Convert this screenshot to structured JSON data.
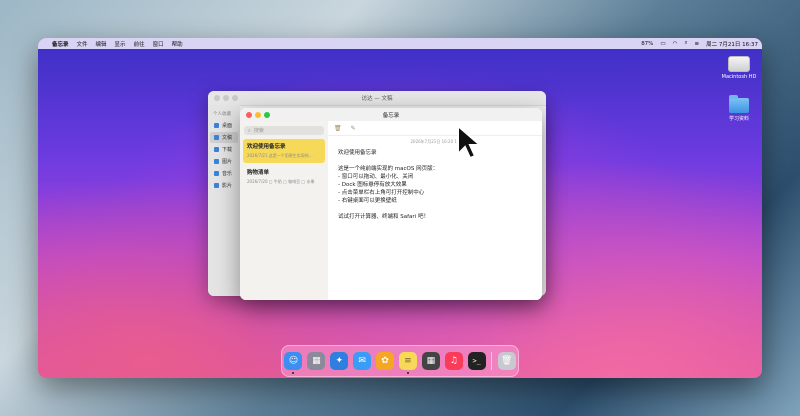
{
  "menubar": {
    "apple": "",
    "app_name": "备忘录",
    "items": [
      "文件",
      "编辑",
      "显示",
      "前往",
      "窗口",
      "帮助"
    ],
    "battery": "87%",
    "datetime": "周二 7月21日 16:37"
  },
  "desktop_icons": [
    {
      "label": "Macintosh HD",
      "icon": "hard-drive-icon"
    },
    {
      "label": "学习资料",
      "icon": "folder-icon"
    }
  ],
  "finder": {
    "title": "访达 — 文稿",
    "section": "个人收藏",
    "items": [
      {
        "label": "桌面",
        "selected": false
      },
      {
        "label": "文稿",
        "selected": true
      },
      {
        "label": "下载",
        "selected": false
      },
      {
        "label": "图片",
        "selected": false
      },
      {
        "label": "音乐",
        "selected": false
      },
      {
        "label": "影片",
        "selected": false
      }
    ]
  },
  "notes": {
    "title": "备忘录",
    "search_placeholder": "搜索",
    "list": [
      {
        "title": "欢迎使用备忘录",
        "meta": "2026/7/21   这是一个用原生实现的…",
        "selected": true
      },
      {
        "title": "购物清单",
        "meta": "2026/7/20   □ 牛奶  □ 咖啡豆  □ 水果",
        "selected": false
      }
    ],
    "toolbar": {
      "delete_icon": "🗑",
      "compose_icon": "✎"
    },
    "date": "2026年7月21日 16:20 16",
    "body_lines": [
      "欢迎使用备忘录",
      "",
      "这是一个纯前端实现的 macOS 网页版：",
      "- 窗口可以拖动、最小化、关闭",
      "- Dock 图标悬停有放大效果",
      "- 点击菜单栏右上角可打开控制中心",
      "- 右键桌面可以更换壁纸",
      "",
      "试试打开计算器、终端和 Safari 吧！"
    ]
  },
  "dock": {
    "items": [
      {
        "name": "finder",
        "glyph": "☺",
        "color": "#3d8ef0",
        "running": true
      },
      {
        "name": "launchpad",
        "glyph": "▦",
        "color": "#8a8a9a",
        "running": false
      },
      {
        "name": "safari",
        "glyph": "✦",
        "color": "#2f7fe0",
        "running": false
      },
      {
        "name": "mail",
        "glyph": "✉",
        "color": "#3b9cf5",
        "running": false
      },
      {
        "name": "photos",
        "glyph": "✿",
        "color": "#f5a623",
        "running": false
      },
      {
        "name": "notes",
        "glyph": "≡",
        "color": "#f7d95a",
        "running": true
      },
      {
        "name": "calculator",
        "glyph": "▦",
        "color": "#444444",
        "running": false
      },
      {
        "name": "music",
        "glyph": "♫",
        "color": "#fa3c5a",
        "running": false
      },
      {
        "name": "terminal",
        "glyph": ">_",
        "color": "#222222",
        "running": false
      },
      {
        "name": "trash",
        "glyph": "🗑",
        "color": "#c8c8d0",
        "running": false
      }
    ]
  }
}
